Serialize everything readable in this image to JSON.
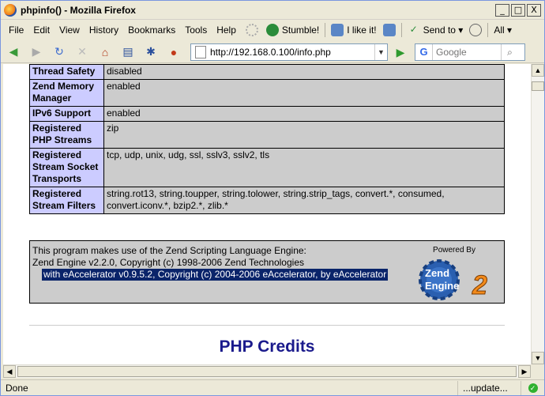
{
  "window": {
    "title": "phpinfo() - Mozilla Firefox",
    "controls": {
      "minimize": "_",
      "maximize": "□",
      "close": "X"
    }
  },
  "menubar": {
    "items": [
      "File",
      "Edit",
      "View",
      "History",
      "Bookmarks",
      "Tools",
      "Help"
    ],
    "stumble": "Stumble!",
    "ilike": "I like it!",
    "sendto": "Send to ▾",
    "all": "All ▾"
  },
  "navbar": {
    "url": "http://192.168.0.100/info.php",
    "search_placeholder": "Google",
    "search_engine": "G"
  },
  "phpinfo": {
    "rows": [
      {
        "key": "Thread Safety",
        "value": "disabled"
      },
      {
        "key": "Zend Memory Manager",
        "value": "enabled"
      },
      {
        "key": "IPv6 Support",
        "value": "enabled"
      },
      {
        "key": "Registered PHP Streams",
        "value": "zip"
      },
      {
        "key": "Registered Stream Socket Transports",
        "value": "tcp, udp, unix, udg, ssl, sslv3, sslv2, tls"
      },
      {
        "key": "Registered Stream Filters",
        "value": "string.rot13, string.toupper, string.tolower, string.strip_tags, convert.*, consumed, convert.iconv.*, bzip2.*, zlib.*"
      }
    ]
  },
  "zend": {
    "line1": "This program makes use of the Zend Scripting Language Engine:",
    "line2": "Zend Engine v2.2.0, Copyright (c) 1998-2006 Zend Technologies",
    "line3": "with eAccelerator v0.9.5.2, Copyright (c) 2004-2006 eAccelerator, by eAccelerator",
    "powered_by": "Powered By",
    "logo_text": "Zend Engine 2"
  },
  "credits_title": "PHP Credits",
  "statusbar": {
    "status": "Done",
    "update": "...update..."
  },
  "colors": {
    "key_cell": "#ccccff",
    "value_cell": "#cccccc",
    "selection": "#0a246a",
    "credits": "#1a1a8c"
  }
}
